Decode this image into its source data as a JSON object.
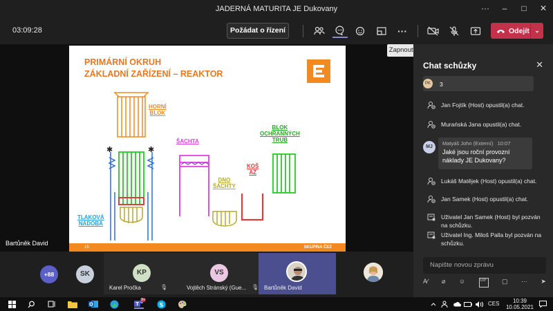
{
  "window": {
    "title": "JADERNÁ MATURITA JE Dukovany"
  },
  "toolbar": {
    "timer": "03:09:28",
    "raise_hand_label": "Požádat o řízení",
    "leave_label": "Odejít",
    "tooltip": "Zapnout kameru (Ctrl+Shift+O)"
  },
  "slide": {
    "title_line1": "PRIMÁRNÍ OKRUH",
    "title_line2": "ZÁKLADNÍ ZAŘÍZENÍ – REAKTOR",
    "labels": {
      "horni_blok_1": "HORNÍ",
      "horni_blok_2": "BLOK",
      "sachta": "ŠACHTA",
      "blok_1": "BLOK",
      "blok_2": "OCHRANNÝCH",
      "blok_3": "TRUB",
      "dno_1": "DNO",
      "dno_2": "ŠACHTY",
      "kos_1": "KOŠ",
      "kos_2": "AZ",
      "tlakova_1": "TLAKOVÁ",
      "tlakova_2": "NÁDOBA"
    },
    "page_number": "15",
    "footer_group": "SKUPINA ČEZ"
  },
  "presenter": {
    "name": "Bartůněk David"
  },
  "chat": {
    "title": "Chat schůzky",
    "partial_count": "3",
    "partial_initials": "PK",
    "events_top": [
      {
        "text": "Jan Fojtík (Host) opustil(a) chat."
      },
      {
        "text": "Murańská Jana opustil(a) chat."
      }
    ],
    "message": {
      "initials": "MJ",
      "author": "Matyáš John (Externí)",
      "time": "10:07",
      "text": "Jaké jsou roční provozní náklady JE Dukovany?"
    },
    "events_bottom": [
      {
        "text": "Lukáš Matějek (Host) opustil(a) chat."
      },
      {
        "text": "Jan Samek (Host) opustil(a) chat."
      },
      {
        "text": "Uživatel Jan Samek (Host) byl pozván na schůzku."
      },
      {
        "text": "Uživatel Ing. Miloš Palla byl pozván na schůzku."
      }
    ],
    "compose_placeholder": "Napište novou zprávu"
  },
  "gallery": {
    "overflow_count": "+88",
    "participants": [
      {
        "initials": "SK",
        "name": "",
        "color": "#c8d0dc"
      },
      {
        "initials": "KP",
        "name": "Karel Pročka",
        "color": "#cfe0c5"
      },
      {
        "initials": "VS",
        "name": "Vojtěch Stránský (Gue...",
        "color": "#ecc7e4"
      },
      {
        "initials": "",
        "name": "Bartůněk David",
        "color": "#4c4f8f"
      }
    ]
  },
  "taskbar": {
    "language": "CES",
    "time": "10:39",
    "date": "10.05.2021",
    "teams_badge": "9+"
  },
  "colors": {
    "accent_orange": "#e87722",
    "leave_red": "#c4314b",
    "green": "#22cc22",
    "magenta": "#e23ce2"
  }
}
